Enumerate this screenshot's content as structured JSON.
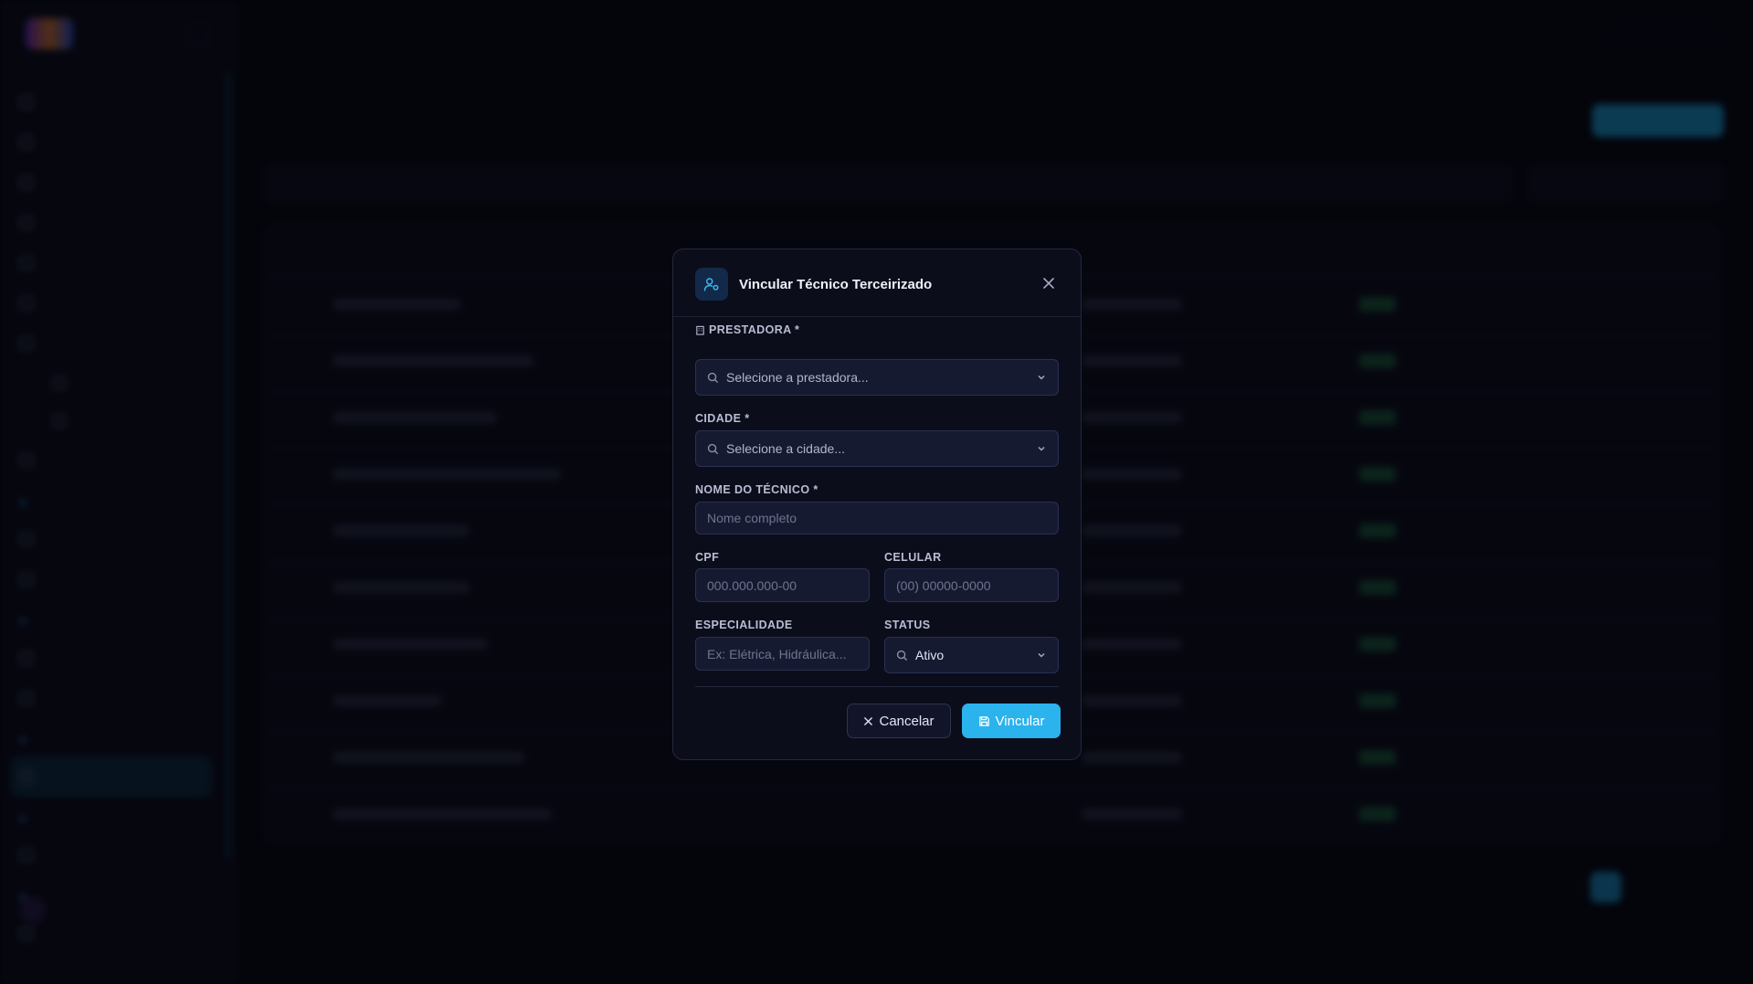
{
  "colors": {
    "accent": "#2bb3ee",
    "modal_bg": "#0b0d1b",
    "field_bg": "#161a31"
  },
  "modal": {
    "title": "Vincular Técnico Terceirizado",
    "icon": "user-cog-icon",
    "prestadora": {
      "label": "PRESTADORA *",
      "placeholder": "Selecione a prestadora..."
    },
    "cidade": {
      "label": "CIDADE *",
      "placeholder": "Selecione a cidade..."
    },
    "nome": {
      "label": "NOME DO TÉCNICO *",
      "placeholder": "Nome completo"
    },
    "cpf": {
      "label": "CPF",
      "placeholder": "000.000.000-00"
    },
    "celular": {
      "label": "CELULAR",
      "placeholder": "(00) 00000-0000"
    },
    "especialidade": {
      "label": "ESPECIALIDADE",
      "placeholder": "Ex: Elétrica, Hidráulica..."
    },
    "status": {
      "label": "STATUS",
      "value": "Ativo"
    },
    "cancel_label": "Cancelar",
    "submit_label": "Vincular"
  }
}
